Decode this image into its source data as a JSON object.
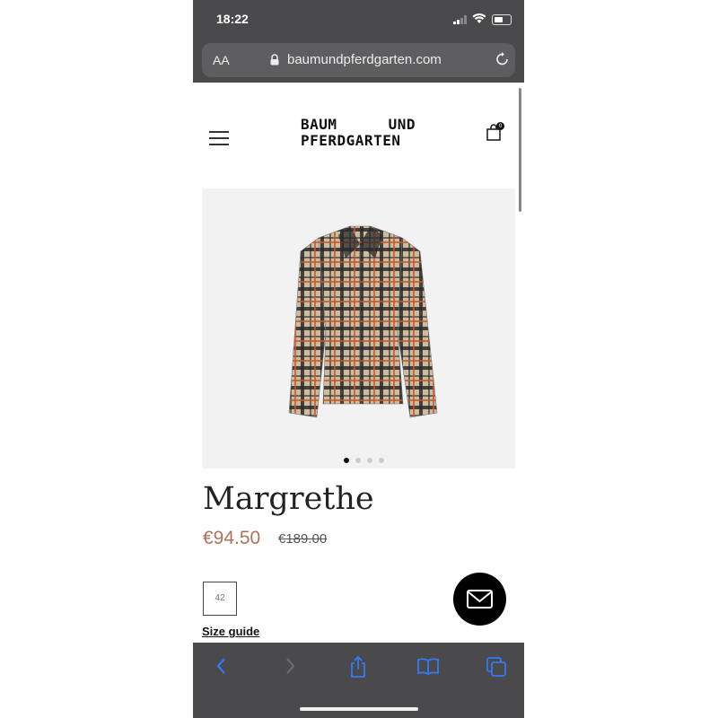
{
  "status_bar": {
    "time": "18:22"
  },
  "browser": {
    "aa_label": "AA",
    "url": "baumundpferdgarten.com"
  },
  "site": {
    "logo_line1_left": "BAUM",
    "logo_line1_right": "UND",
    "logo_line2": "PFERDGARTEN",
    "cart_count": "0"
  },
  "gallery": {
    "image_count": 4,
    "active_index": 0
  },
  "product": {
    "name": "Margrethe",
    "price": "€94.50",
    "original_price": "€189.00",
    "size": "42",
    "size_guide_label": "Size guide"
  },
  "colors": {
    "chrome": "#4a4a4c",
    "price_accent": "#b0715a",
    "plaid_base": "#c9b79a",
    "plaid_dark": "#1f1f22",
    "plaid_orange": "#c8572a"
  },
  "icons": {
    "menu": "hamburger-icon",
    "cart": "shopping-bag-icon",
    "mail": "envelope-icon",
    "back": "chevron-left-icon",
    "forward": "chevron-right-icon",
    "share": "share-icon",
    "bookmarks": "book-icon",
    "tabs": "tabs-icon"
  }
}
